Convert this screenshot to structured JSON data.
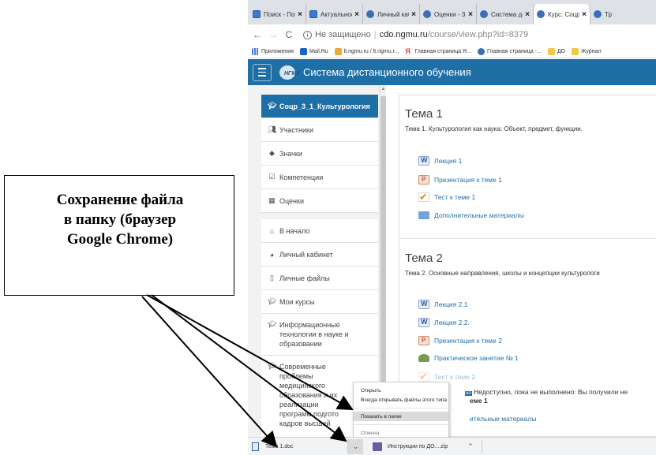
{
  "tabs": [
    {
      "label": "Поиск - Поч",
      "icon": "mail-icon"
    },
    {
      "label": "Актуальнос",
      "icon": "mail-icon"
    },
    {
      "label": "Личный каб",
      "icon": "globe-icon"
    },
    {
      "label": "Оценки - За",
      "icon": "globe-icon"
    },
    {
      "label": "Система дис",
      "icon": "globe-icon"
    },
    {
      "label": "Курс: Соцр",
      "icon": "globe-icon",
      "active": true
    },
    {
      "label": "Тр",
      "icon": "globe-icon"
    }
  ],
  "address": {
    "not_secure": "Не защищено",
    "host": "cdo.ngmu.ru",
    "path": "/course/view.php?id=8379"
  },
  "bookmarks": [
    {
      "label": "Приложения",
      "icon": "apps-icon"
    },
    {
      "label": "Mail.Ru",
      "icon": "mailru-icon"
    },
    {
      "label": "lt.ngmu.ru / lt.ngmu.r...",
      "icon": "bookmark-icon"
    },
    {
      "label": "Главная страница Я...",
      "icon": "yandex-icon"
    },
    {
      "label": "Главная страница -...",
      "icon": "globe-icon"
    },
    {
      "label": "ДО",
      "icon": "folder-icon"
    },
    {
      "label": "Журнал",
      "icon": "folder-icon"
    }
  ],
  "site": {
    "logo_text": "НГМУ",
    "title": "Система дистанционного обучения"
  },
  "sidebar": {
    "course": "Соцр_3_1_Культурология",
    "group1": [
      {
        "label": "Участники",
        "icon": "users-icon"
      },
      {
        "label": "Значки",
        "icon": "shield-icon"
      },
      {
        "label": "Компетенции",
        "icon": "checkbox-icon"
      },
      {
        "label": "Оценки",
        "icon": "grid-icon"
      }
    ],
    "group2": [
      {
        "label": "В начало",
        "icon": "home-icon"
      },
      {
        "label": "Личный кабинет",
        "icon": "dashboard-icon"
      },
      {
        "label": "Личные файлы",
        "icon": "file-icon"
      },
      {
        "label": "Мои курсы",
        "icon": "mortarboard-icon"
      }
    ],
    "course_links": [
      {
        "lines": [
          "Информационные",
          "технологии в науке и",
          "образовании"
        ]
      },
      {
        "lines": [
          "Современные",
          "проблемы",
          "медицинского",
          "образования и их",
          "реализации",
          "программ подгото",
          "кадров высшей"
        ]
      }
    ]
  },
  "sections": [
    {
      "title": "Тема 1",
      "summary": "Тема 1. Культурология как наука: Объект, предмет, функции.",
      "activities": [
        {
          "label": "Лекция 1",
          "type": "lecture"
        },
        {
          "label": "Презентация к теме 1",
          "type": "pres"
        },
        {
          "label": "Тест к теме 1",
          "type": "test"
        },
        {
          "label": "Дополнительные материалы",
          "type": "folder"
        }
      ]
    },
    {
      "title": "Тема 2",
      "summary": "Тема 2. Основные направления, школы и концепции культурологи",
      "activities": [
        {
          "label": "Лекция 2.1",
          "type": "lecture"
        },
        {
          "label": "Лекция 2.2.",
          "type": "lecture"
        },
        {
          "label": "Презентация к теме 2",
          "type": "pres"
        },
        {
          "label": "Практическое занятие № 1",
          "type": "prac"
        },
        {
          "label": "Тест к теме 2",
          "type": "test"
        },
        {
          "label": "ительные материалы",
          "type": "folder"
        }
      ],
      "restriction": "Недоступно, пока не выполнено: Вы получили не",
      "restriction_target": "еме 1",
      "restriction_badge": "но"
    }
  ],
  "context_menu": {
    "items": [
      "Открыть",
      "Всегда открывать файлы этого типа",
      "Показать в папке",
      "Отмена"
    ],
    "highlighted_index": 2
  },
  "downloads": [
    {
      "label": "Тема 1.doc",
      "icon": "word-doc-icon"
    },
    {
      "label": "Инструкции по ДО....zip",
      "icon": "archive-icon"
    }
  ],
  "callout": {
    "lines": [
      "Сохранение файла",
      "в папку (браузер",
      "Google Chrome)"
    ]
  }
}
